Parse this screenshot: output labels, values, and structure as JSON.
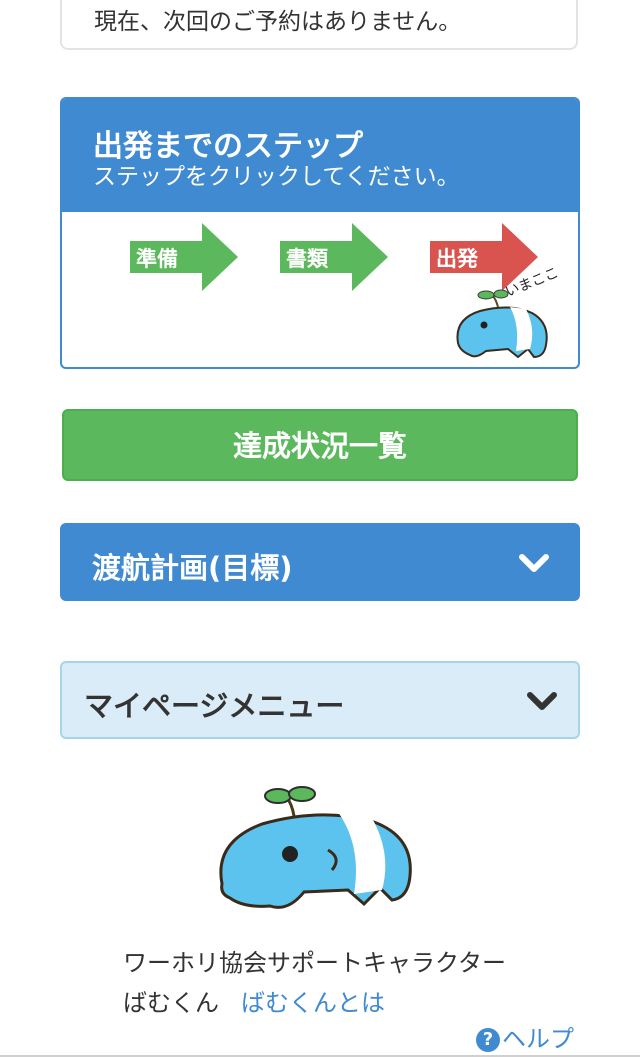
{
  "reservation": {
    "text": "現在、次回のご予約はありません。"
  },
  "steps": {
    "title": "出発までのステップ",
    "subtitle": "ステップをクリックしてください。",
    "items": [
      {
        "label": "準備",
        "color": "#5cb85c"
      },
      {
        "label": "書類",
        "color": "#5cb85c"
      },
      {
        "label": "出発",
        "color": "#d9534f"
      }
    ],
    "current_label": "いまここ"
  },
  "progress_button": {
    "label": "達成状況一覧"
  },
  "plan": {
    "label": "渡航計画(目標)",
    "icon": "chevron-down-icon"
  },
  "mypage_menu": {
    "label": "マイページメニュー",
    "icon": "chevron-down-icon"
  },
  "mascot": {
    "caption": "ワーホリ協会サポートキャラクター",
    "name": "ばむくん",
    "link": "ばむくんとは"
  },
  "help": {
    "icon_glyph": "?",
    "label": "ヘルプ"
  },
  "colors": {
    "primary": "#3f8ad0",
    "success": "#5cb85c",
    "danger": "#d9534f",
    "light": "#d9ecf7"
  }
}
